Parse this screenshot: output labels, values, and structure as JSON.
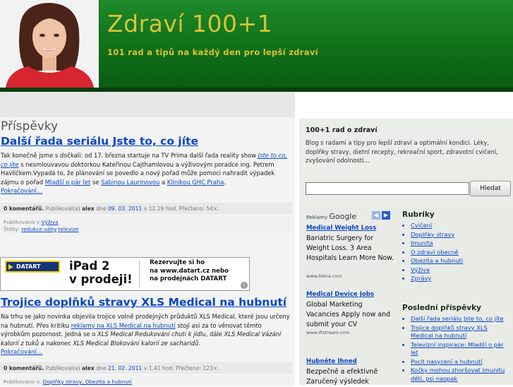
{
  "header": {
    "title": "Zdraví 100+1",
    "tagline": "101 rad a tipů na každý den pro lepší zdraví"
  },
  "content": {
    "heading": "Příspěvky",
    "posts": [
      {
        "title": "Další řada seriálu Jste to, co jíte",
        "body": [
          {
            "t": "Tak konečně jsme s dočkali: od 17. března startuje na TV Prima další řada reality show ",
            "link": false
          },
          {
            "t": "Jste to co, co jíte",
            "link": true,
            "italic": true
          },
          {
            "t": " s nesmlouvavou doktorkou Kateřinou Cajthamlovou a výživovým poradce ing. Petrem Havlíčkem.Vypadá to, že plánování se povedlo a nový pořad může pomoci nahradit výpadek zájmu o pořad ",
            "link": false
          },
          {
            "t": "Mladší o pár let",
            "link": true
          },
          {
            "t": " se ",
            "link": false
          },
          {
            "t": "Sabinou Laurinovou",
            "link": true
          },
          {
            "t": " a ",
            "link": false
          },
          {
            "t": "Klinikou GHC Praha",
            "link": true
          },
          {
            "t": ".",
            "link": false
          }
        ],
        "more": "Pokračování…",
        "meta": {
          "comments": "0 komentářů.",
          "published_by": "Publikoval(a)",
          "author": "alex",
          "day_label": "dne",
          "date": "09. 03. 2011",
          "time": "v 12.19 hod.",
          "reads": "Přečteno: 54×."
        },
        "published_in_label": "Publikováno v",
        "category": "Výživa",
        "tags_label": "Štítky:",
        "tags": [
          "redukce váhy",
          "televize"
        ]
      },
      {
        "title": "Trojice doplňků stravy XLS Medical na hubnutí",
        "body": [
          {
            "t": "Na trhu se jako novinka objevila trojice volně prodejných průduktů XLS Medical, které jsou určeny na hubnutí. Přes kritiku ",
            "link": false
          },
          {
            "t": "reklamy na XLS Medical na hubnutí",
            "link": true
          },
          {
            "t": " stojí asi za to věnovat těmto výrobkům pozornost. Jedná se o ",
            "link": false
          },
          {
            "t": "XLS Medical Redukování chuti k jídlu",
            "link": false,
            "italic": true
          },
          {
            "t": ", dále ",
            "link": false
          },
          {
            "t": "XLS Medical Vázání kalorií z tuků",
            "link": false,
            "italic": true
          },
          {
            "t": " a nakonec ",
            "link": false
          },
          {
            "t": "XLS Medical Blokování kalorií ze sacharidů",
            "link": false,
            "italic": true
          },
          {
            "t": ".",
            "link": false
          }
        ],
        "more": "Pokračování…",
        "meta": {
          "comments": "0 komentářů.",
          "published_by": "Publikoval(a)",
          "author": "alex",
          "day_label": "dne",
          "date": "21. 02. 2011",
          "time": "v 1.41 hod.",
          "reads": "Přečteno: 123×."
        },
        "published_in_label": "Publikováno v:",
        "categories_text": "Doplňky stravy, Obezita a hubnutí"
      }
    ],
    "banner": {
      "logo": "DATART",
      "product": "iPad 2\nv prodeji!",
      "text": "Rezervujte si ho\nna www.datart.cz nebo\nna prodejnách DATART",
      "info": "i"
    }
  },
  "sidebar": {
    "about_title": "100+1 rad o zdraví",
    "about_text": "Blog s radami a tipy pro lepší zdraví a optimální kondici. Léky, doplňky stravy, dietní recepty, rekreační sport, zdravotní cvičení, zvyšování odolnosti...",
    "search": {
      "value": "",
      "button": "Hledat"
    },
    "ads": {
      "label": "Reklamy",
      "brand": "Google",
      "prev": "◀",
      "next": "▶",
      "items": [
        {
          "title": "Medical Weight Loss",
          "text": "Bariatric Surgery for Weight Loss. 3 Area Hospitals Learn More Now.",
          "url": "www.Allina.com"
        },
        {
          "title": "Medical Device Jobs",
          "text": "Global Marketing Vacancies Apply now and submit your CV",
          "url": "www.iftstream.com"
        },
        {
          "title": "Hubněte Ihned",
          "text": "Bezpečně a efektivně Zaručený výsledek",
          "url": ""
        }
      ]
    },
    "rubriky": {
      "title": "Rubriky",
      "items": [
        "Cvičení",
        "Doplňky stravy",
        "Imunita",
        "O zdraví obecně",
        "Obezita a hubnutí",
        "Výživa",
        "Zprávy"
      ]
    },
    "posledni": {
      "title": "Poslední příspěvky",
      "items": [
        "Další řada seriálu Jste to, co jíte",
        "Trojice doplňků stravy XLS Medical na hubnutí",
        "Televizní inspirace: Mladší o pár let",
        "Pocit nasycení a hubnutí",
        "Kočky mohou zhoršovat imunitu dětí, psi naopak"
      ]
    }
  },
  "colors": {
    "header_green": "#107019",
    "title_gold": "#d8c23a",
    "link_blue": "#0a47c2"
  }
}
